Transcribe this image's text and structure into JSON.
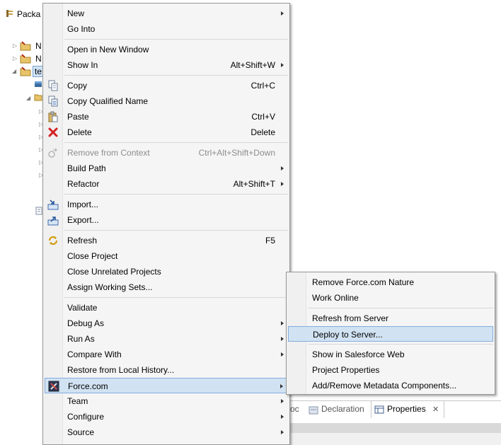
{
  "package_explorer": {
    "title": "Packa",
    "tree": [
      {
        "label": "N",
        "expanded": false
      },
      {
        "label": "N",
        "expanded": false
      },
      {
        "label": "te",
        "expanded": true,
        "selected": true
      }
    ]
  },
  "context_menu": {
    "items": [
      {
        "label": "New",
        "submenu": true
      },
      {
        "label": "Go Into"
      },
      {
        "sep": true
      },
      {
        "label": "Open in New Window"
      },
      {
        "label": "Show In",
        "accel": "Alt+Shift+W",
        "submenu": true
      },
      {
        "sep": true
      },
      {
        "label": "Copy",
        "accel": "Ctrl+C",
        "icon": "copy-icon"
      },
      {
        "label": "Copy Qualified Name",
        "icon": "copy-qualified-name-icon"
      },
      {
        "label": "Paste",
        "accel": "Ctrl+V",
        "icon": "paste-icon"
      },
      {
        "label": "Delete",
        "accel": "Delete",
        "icon": "delete-icon"
      },
      {
        "sep": true
      },
      {
        "label": "Remove from Context",
        "accel": "Ctrl+Alt+Shift+Down",
        "disabled": true,
        "icon": "remove-from-context-icon"
      },
      {
        "label": "Build Path",
        "submenu": true
      },
      {
        "label": "Refactor",
        "accel": "Alt+Shift+T",
        "submenu": true
      },
      {
        "sep": true
      },
      {
        "label": "Import...",
        "icon": "import-icon"
      },
      {
        "label": "Export...",
        "icon": "export-icon"
      },
      {
        "sep": true
      },
      {
        "label": "Refresh",
        "accel": "F5",
        "icon": "refresh-icon"
      },
      {
        "label": "Close Project"
      },
      {
        "label": "Close Unrelated Projects"
      },
      {
        "label": "Assign Working Sets..."
      },
      {
        "sep": true
      },
      {
        "label": "Validate"
      },
      {
        "label": "Debug As",
        "submenu": true
      },
      {
        "label": "Run As",
        "submenu": true
      },
      {
        "label": "Compare With",
        "submenu": true
      },
      {
        "label": "Restore from Local History..."
      },
      {
        "label": "Force.com",
        "submenu": true,
        "highlighted": true,
        "icon": "force-com-icon"
      },
      {
        "label": "Team",
        "submenu": true
      },
      {
        "label": "Configure",
        "submenu": true
      },
      {
        "label": "Source",
        "submenu": true
      }
    ]
  },
  "force_submenu": {
    "items": [
      {
        "label": "Remove Force.com Nature"
      },
      {
        "label": "Work Online"
      },
      {
        "sep": true
      },
      {
        "label": "Refresh from Server"
      },
      {
        "label": "Deploy to Server...",
        "highlighted": true
      },
      {
        "sep": true
      },
      {
        "label": "Show in Salesforce Web"
      },
      {
        "label": "Project Properties"
      },
      {
        "label": "Add/Remove Metadata Components..."
      }
    ]
  },
  "bottom_tabs": {
    "partial": "oc",
    "declaration": "Declaration",
    "properties": "Properties"
  },
  "colors": {
    "highlight_bg": "#d1e2f2",
    "highlight_border": "#84acdd",
    "menu_bg": "#f5f5f5"
  }
}
